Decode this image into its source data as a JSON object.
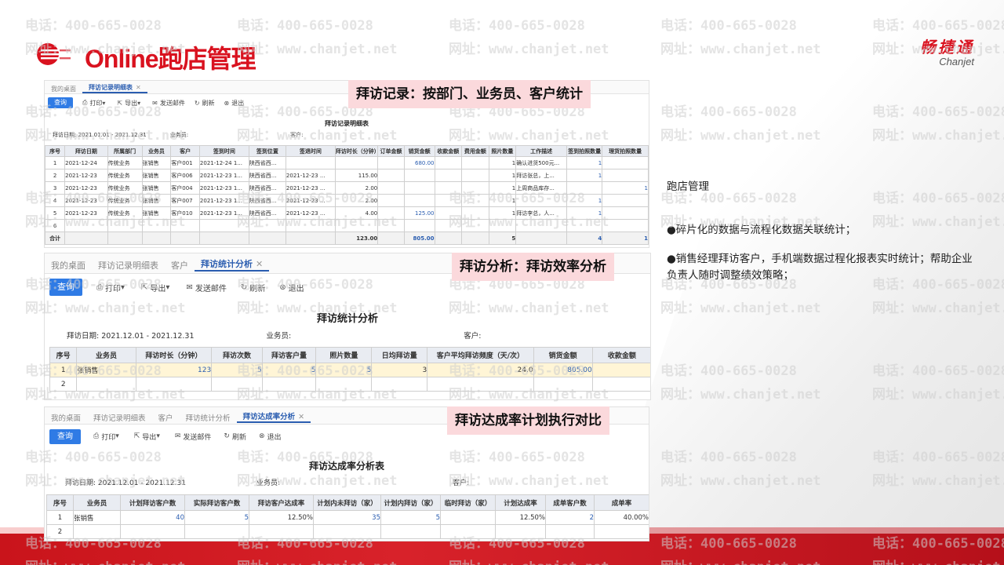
{
  "header": {
    "title": "Online跑店管理",
    "brand_cn": "畅捷通",
    "brand_en": "Chanjet"
  },
  "watermark": {
    "phone": "电话：400-665-0028",
    "web": "网址：www.chanjet.net"
  },
  "colors": {
    "accent": "#d9121f",
    "link": "#2a5db0",
    "query_button": "#2f7be5",
    "callout_bg": "#fbd9dc"
  },
  "callouts": {
    "c1": "拜访记录：按部门、业务员、客户统计",
    "c2": "拜访分析：拜访效率分析",
    "c3": "拜访达成率计划执行对比"
  },
  "toolbar": {
    "query": "查询",
    "print": "打印",
    "export": "导出",
    "send_mail": "发送邮件",
    "refresh": "刷新",
    "exit": "退出"
  },
  "panel1": {
    "tabs": [
      "我的桌面",
      "拜访记录明细表"
    ],
    "report_title": "拜访记录明细表",
    "filter_date_label": "拜访日期:",
    "filter_date": "2021.01.01 - 2021.12.31",
    "filter_sales_label": "业务员:",
    "filter_customer_label": "客户:",
    "columns": [
      "序号",
      "拜访日期",
      "所属部门",
      "业务员",
      "客户",
      "签到时间",
      "签到位置",
      "签退时间",
      "拜访时长（分钟）",
      "订单金额",
      "销货金额",
      "收款金额",
      "费用金额",
      "照片数量",
      "工作描述",
      "签到拍照数量",
      "理货拍照数量"
    ],
    "rows": [
      [
        "1",
        "2021-12-24",
        "传统业务",
        "张销售",
        "客户001",
        "2021-12-24 1...",
        "陕西省西...",
        "",
        "",
        "",
        "680.00",
        "",
        "",
        "1",
        "确认进货500元...",
        "1",
        ""
      ],
      [
        "2",
        "2021-12-23",
        "传统业务",
        "张销售",
        "客户006",
        "2021-12-23 1...",
        "陕西省西...",
        "2021-12-23 ...",
        "115.00",
        "",
        "",
        "",
        "",
        "1",
        "拜访张总，上...",
        "1",
        ""
      ],
      [
        "3",
        "2021-12-23",
        "传统业务",
        "张销售",
        "客户004",
        "2021-12-23 1...",
        "陕西省西...",
        "2021-12-23 ...",
        "2.00",
        "",
        "",
        "",
        "",
        "1",
        "上周商品库存...",
        "",
        "1"
      ],
      [
        "4",
        "2021-12-23",
        "传统业务",
        "张销售",
        "客户007",
        "2021-12-23 1...",
        "陕西省西...",
        "2021-12-23 ...",
        "2.00",
        "",
        "",
        "",
        "",
        "1",
        "",
        "1",
        ""
      ],
      [
        "5",
        "2021-12-23",
        "传统业务",
        "张销售",
        "客户010",
        "2021-12-23 1...",
        "陕西省西...",
        "2021-12-23 ...",
        "4.00",
        "",
        "125.00",
        "",
        "",
        "1",
        "拜访李总，人...",
        "1",
        ""
      ],
      [
        "6",
        "",
        "",
        "",
        "",
        "",
        "",
        "",
        "",
        "",
        "",
        "",
        "",
        "",
        "",
        "",
        ""
      ]
    ],
    "total": [
      "合计",
      "",
      "",
      "",
      "",
      "",
      "",
      "",
      "123.00",
      "",
      "805.00",
      "",
      "",
      "5",
      "",
      "4",
      "1"
    ]
  },
  "panel2": {
    "tabs": [
      "我的桌面",
      "拜访记录明细表",
      "客户",
      "拜访统计分析"
    ],
    "report_title": "拜访统计分析",
    "filter_date_label": "拜访日期:",
    "filter_date": "2021.12.01 - 2021.12.31",
    "filter_sales_label": "业务员:",
    "filter_customer_label": "客户:",
    "columns": [
      "序号",
      "业务员",
      "拜访时长（分钟）",
      "拜访次数",
      "拜访客户量",
      "照片数量",
      "日均拜访量",
      "客户平均拜访频度（天/次）",
      "销货金额",
      "收款金额"
    ],
    "rows": [
      [
        "1",
        "张销售",
        "123",
        "5",
        "5",
        "5",
        "3",
        "24.0",
        "805.00",
        ""
      ],
      [
        "2",
        "",
        "",
        "",
        "",
        "",
        "",
        "",
        "",
        ""
      ]
    ]
  },
  "panel3": {
    "tabs": [
      "我的桌面",
      "拜访记录明细表",
      "客户",
      "拜访统计分析",
      "拜访达成率分析"
    ],
    "report_title": "拜访达成率分析表",
    "filter_date_label": "拜访日期:",
    "filter_date": "2021.12.01 - 2021.12.31",
    "filter_sales_label": "业务员:",
    "filter_customer_label": "客户:",
    "columns": [
      "序号",
      "业务员",
      "计划拜访客户数",
      "实际拜访客户数",
      "拜访客户达成率",
      "计划内未拜访（家）",
      "计划内拜访（家）",
      "临时拜访（家）",
      "计划达成率",
      "成单客户数",
      "成单率"
    ],
    "rows": [
      [
        "1",
        "张销售",
        "40",
        "5",
        "12.50%",
        "35",
        "5",
        "",
        "12.50%",
        "2",
        "40.00%"
      ],
      [
        "2",
        "",
        "",
        "",
        "",
        "",
        "",
        "",
        "",
        "",
        ""
      ]
    ]
  },
  "notes": {
    "heading": "跑店管理",
    "b1": "●碎片化的数据与流程化数据关联统计；",
    "b2": "●销售经理拜访客户，手机端数据过程化报表实时统计；帮助企业负责人随时调整绩效策略；"
  }
}
